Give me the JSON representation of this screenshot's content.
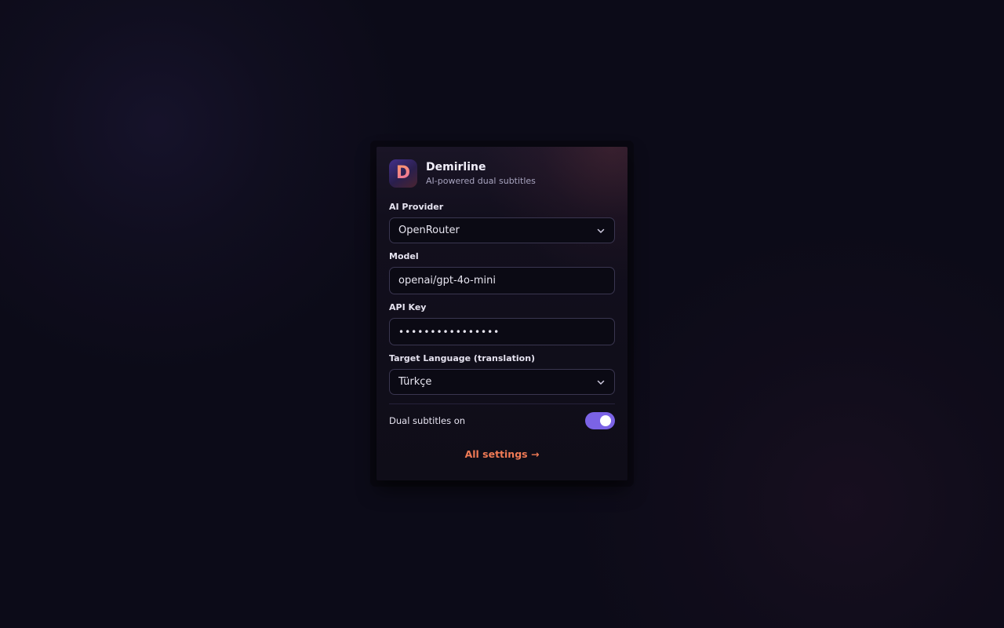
{
  "app": {
    "name": "Demirline",
    "tagline": "AI-powered dual subtitles",
    "logo_letter": "D",
    "logo_icon": "demirline-logo-icon"
  },
  "form": {
    "provider": {
      "label": "AI Provider",
      "value": "OpenRouter",
      "icon": "chevron-down-icon"
    },
    "model": {
      "label": "Model",
      "value": "openai/gpt-4o-mini"
    },
    "api_key": {
      "label": "API Key",
      "value": "••••••••••••••••"
    },
    "target_language": {
      "label": "Target Language (translation)",
      "value": "Türkçe",
      "icon": "chevron-down-icon"
    },
    "dual_subtitles": {
      "label": "Dual subtitles on",
      "enabled": true
    }
  },
  "footer": {
    "settings_link": "All settings →"
  },
  "colors": {
    "accent_toggle": "#7b63e6",
    "link": "#f07a55",
    "background": "#0c0b18",
    "panel": "#120f1d"
  }
}
